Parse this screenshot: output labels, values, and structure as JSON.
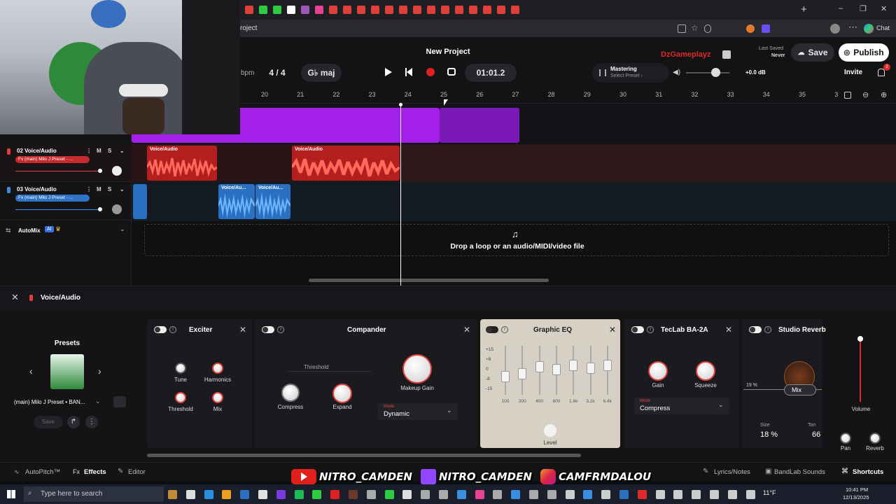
{
  "browser": {
    "tab_title_fragment": "roject",
    "tab_icon_colors": [
      "#e0403a",
      "#2ecc40",
      "#2ecc40",
      "#fff",
      "#9b59b6",
      "#e84393",
      "#e0403a",
      "#e0403a",
      "#e0403a",
      "#e0403a",
      "#e0403a",
      "#e0403a",
      "#e0403a",
      "#e0403a",
      "#e0403a",
      "#e0403a",
      "#e0403a",
      "#e0403a",
      "#e0403a",
      "#e0403a"
    ],
    "new_tab": "+",
    "chat": "Chat",
    "window_controls": [
      "–",
      "❐",
      "✕"
    ]
  },
  "header": {
    "project_title": "New Project",
    "bpm_label": "bpm",
    "time_signature": "4 / 4",
    "key": "G♭ maj",
    "time_display": "01:01.2",
    "mastering_label": "Mastering",
    "mastering_sub": "Select Preset ›",
    "volume_db": "+0.0 dB",
    "user_name": "DzGameplayz",
    "last_saved_label": "Last Saved",
    "last_saved_value": "Never",
    "save_label": "Save",
    "publish_label": "Publish",
    "invite_label": "Invite",
    "notif_count": "2"
  },
  "ruler": {
    "bars": [
      "20",
      "21",
      "22",
      "23",
      "24",
      "25",
      "26",
      "27",
      "28",
      "29",
      "30",
      "31",
      "32",
      "33",
      "34",
      "35",
      "3"
    ]
  },
  "tracks": [
    {
      "num": "02",
      "name": "Voice/Audio",
      "fx": "Fx (main) Milo J Preset - ...",
      "color": "#e0403a"
    },
    {
      "num": "03",
      "name": "Voice/Audio",
      "fx": "Fx (main) Milo J Preset - ...",
      "color": "#3a8fe0"
    }
  ],
  "automix": {
    "label": "AutoMix",
    "ai_badge": "AI"
  },
  "clips": {
    "voice_label": "Voice/Audio",
    "voice_short": "Voice/Au..."
  },
  "dropzone_text": "Drop a loop or an audio/MIDI/video file",
  "fx_panel": {
    "title": "Voice/Audio",
    "presets_title": "Presets",
    "preset_name": "(main) Milo J Preset • BAN...",
    "save_label": "Save"
  },
  "exciter": {
    "title": "Exciter",
    "knobs": [
      "Tune",
      "Harmonics",
      "Threshold",
      "Mix"
    ]
  },
  "compander": {
    "title": "Compander",
    "threshold": "Threshold",
    "compress": "Compress",
    "expand": "Expand",
    "makeup": "Makeup Gain",
    "mode_cap": "Mode",
    "mode_val": "Dynamic"
  },
  "graphic_eq": {
    "title": "Graphic EQ",
    "db_scale": [
      "+15",
      "+8",
      "0",
      "-8",
      "-15"
    ],
    "bands": [
      "100",
      "200",
      "400",
      "800",
      "1.6k",
      "3.2k",
      "6.4k"
    ],
    "level": "Level"
  },
  "teclab": {
    "title": "TecLab BA-2A",
    "gain": "Gain",
    "squeeze": "Squeeze",
    "mode_cap": "Mode",
    "mode_val": "Compress"
  },
  "reverb": {
    "title": "Studio Reverb",
    "mix": "Mix",
    "pct": "19 %",
    "size_label": "Size",
    "size_val": "18 %",
    "tone_label": "Ton",
    "tone_val": "66"
  },
  "master": {
    "volume": "Volume",
    "pan": "Pan",
    "reverb": "Reverb"
  },
  "footer": {
    "autopitch": "AutoPitch™",
    "effects": "Effects",
    "editor": "Editor",
    "lyrics": "Lyrics/Notes",
    "sounds": "BandLab Sounds",
    "shortcuts": "Shortcuts"
  },
  "socials": [
    {
      "handle": "NITRO_CAMDEN",
      "color": "#e0201a"
    },
    {
      "handle": "NITRO_CAMDEN",
      "color": "#9146ff"
    },
    {
      "handle": "CAMFRMDALOU",
      "color": "#d6297a"
    }
  ],
  "taskbar": {
    "search_placeholder": "Type here to search",
    "weather": "11°F",
    "time": "10:41 PM",
    "date": "12/13/2025"
  }
}
